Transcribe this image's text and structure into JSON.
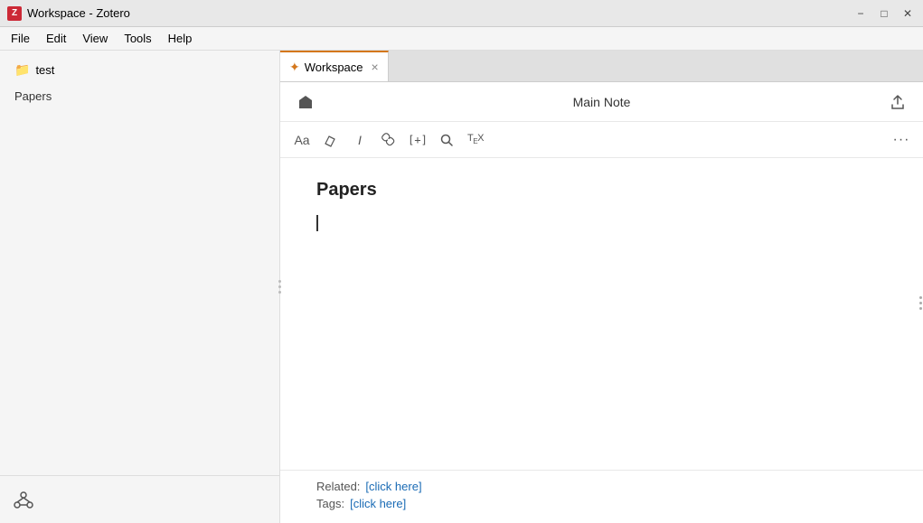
{
  "titlebar": {
    "title": "Workspace - Zotero",
    "zotero_icon": "Z",
    "controls": {
      "minimize": "−",
      "maximize": "□",
      "close": "✕"
    }
  },
  "menubar": {
    "items": [
      "File",
      "Edit",
      "View",
      "Tools",
      "Help"
    ]
  },
  "sidebar": {
    "folder": {
      "icon": "📁",
      "label": "test"
    },
    "collection_label": "Papers",
    "bottom_icon": "⬡"
  },
  "tabs": [
    {
      "id": "tab-workspace",
      "label": "Workspace",
      "active": true,
      "closable": true
    }
  ],
  "note": {
    "header": {
      "home_icon": "⬟",
      "title": "Main Note",
      "export_icon": "↑"
    },
    "toolbar": {
      "font_size": "Aa",
      "highlight": "◈",
      "italic": "𝐼",
      "link": "🔗",
      "insert": "[+]",
      "search": "🔍",
      "tex": "TEX",
      "more": "•••"
    },
    "heading": "Papers",
    "footer": {
      "related_label": "Related:",
      "related_link": "[click here]",
      "tags_label": "Tags:",
      "tags_link": "[click here]"
    }
  }
}
